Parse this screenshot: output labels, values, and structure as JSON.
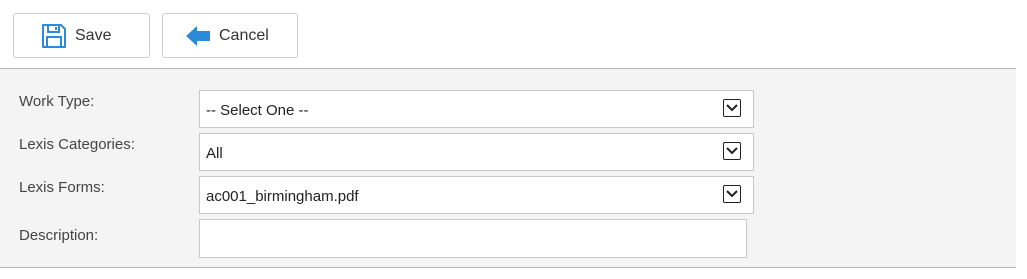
{
  "toolbar": {
    "save_label": "Save",
    "save_icon": "floppy-disk-icon",
    "cancel_label": "Cancel",
    "cancel_icon": "arrow-left-icon",
    "accent_color": "#2b8ad9"
  },
  "form": {
    "work_type": {
      "label": "Work Type:",
      "value": "-- Select One --"
    },
    "lexis_categories": {
      "label": "Lexis Categories:",
      "value": "All"
    },
    "lexis_forms": {
      "label": "Lexis Forms:",
      "value": "ac001_birmingham.pdf"
    },
    "description": {
      "label": "Description:",
      "value": ""
    }
  }
}
